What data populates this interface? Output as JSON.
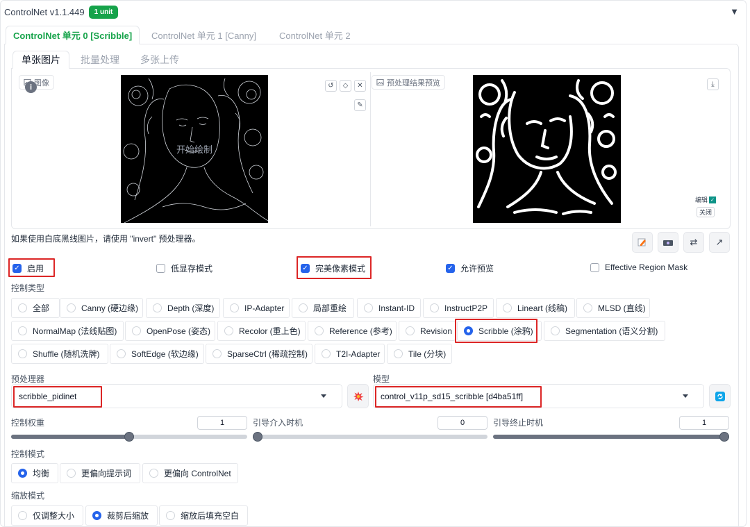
{
  "header": {
    "title": "ControlNet v1.1.449",
    "badge": "1 unit",
    "collapse_symbol": "▼"
  },
  "unit_tabs": [
    {
      "label": "ControlNet 单元 0 [Scribble]",
      "active": true
    },
    {
      "label": "ControlNet 单元 1 [Canny]",
      "active": false
    },
    {
      "label": "ControlNet 单元 2",
      "active": false
    }
  ],
  "image_tabs": [
    {
      "label": "单张图片",
      "active": true
    },
    {
      "label": "批量处理",
      "active": false
    },
    {
      "label": "多张上传",
      "active": false
    }
  ],
  "image_input": {
    "label": "图像",
    "label_icon": "image-icon",
    "info": "i",
    "overlay_text": "开始绘制",
    "tools": [
      "undo-icon",
      "eraser-icon",
      "close-icon",
      "brush-icon"
    ]
  },
  "preview": {
    "label": "预处理结果预览",
    "label_icon": "image-icon",
    "download_icon": "download-icon",
    "edit_label": "编辑",
    "close_label": "关闭"
  },
  "hint": "如果使用白底黑线图片，请使用 \"invert\" 预处理器。",
  "tool_buttons": [
    "edit-canvas-icon",
    "camera-icon",
    "swap-icon",
    "send-dimensions-icon"
  ],
  "checkboxes": [
    {
      "label": "启用",
      "checked": true,
      "highlight": true
    },
    {
      "label": "低显存模式",
      "checked": false,
      "highlight": false
    },
    {
      "label": "完美像素模式",
      "checked": true,
      "highlight": true
    },
    {
      "label": "允许预览",
      "checked": true,
      "highlight": false
    },
    {
      "label": "Effective Region Mask",
      "checked": false,
      "highlight": false
    }
  ],
  "control_type": {
    "label": "控制类型",
    "rows": [
      [
        {
          "label": "全部",
          "selected": false
        },
        {
          "label": "Canny (硬边缘)",
          "selected": false
        },
        {
          "label": "Depth (深度)",
          "selected": false
        },
        {
          "label": "IP-Adapter",
          "selected": false
        },
        {
          "label": "局部重绘",
          "selected": false
        },
        {
          "label": "Instant-ID",
          "selected": false
        },
        {
          "label": "InstructP2P",
          "selected": false
        },
        {
          "label": "Lineart (线稿)",
          "selected": false
        },
        {
          "label": "MLSD (直线)",
          "selected": false
        }
      ],
      [
        {
          "label": "NormalMap (法线贴图)",
          "selected": false
        },
        {
          "label": "OpenPose (姿态)",
          "selected": false
        },
        {
          "label": "Recolor (重上色)",
          "selected": false
        },
        {
          "label": "Reference (参考)",
          "selected": false
        },
        {
          "label": "Revision",
          "selected": false
        },
        {
          "label": "Scribble (涂鸦)",
          "selected": true
        },
        {
          "label": "Segmentation (语义分割)",
          "selected": false
        }
      ],
      [
        {
          "label": "Shuffle (随机洗牌)",
          "selected": false
        },
        {
          "label": "SoftEdge (软边缘)",
          "selected": false
        },
        {
          "label": "SparseCtrl (稀疏控制)",
          "selected": false
        },
        {
          "label": "T2I-Adapter",
          "selected": false
        },
        {
          "label": "Tile (分块)",
          "selected": false
        }
      ]
    ]
  },
  "preprocessor": {
    "label": "预处理器",
    "value": "scribble_pidinet",
    "run_icon": "explosion-icon"
  },
  "model": {
    "label": "模型",
    "value": "control_v11p_sd15_scribble [d4ba51ff]",
    "refresh_icon": "refresh-icon"
  },
  "sliders": [
    {
      "label": "控制权重",
      "value": "1",
      "fraction": 0.5
    },
    {
      "label": "引导介入时机",
      "value": "0",
      "fraction": 0.0
    },
    {
      "label": "引导终止时机",
      "value": "1",
      "fraction": 1.0
    }
  ],
  "control_mode": {
    "label": "控制模式",
    "options": [
      {
        "label": "均衡",
        "selected": true
      },
      {
        "label": "更偏向提示词",
        "selected": false
      },
      {
        "label": "更偏向 ControlNet",
        "selected": false
      }
    ]
  },
  "resize_mode": {
    "label": "缩放模式",
    "options": [
      {
        "label": "仅调整大小",
        "selected": false
      },
      {
        "label": "裁剪后缩放",
        "selected": true
      },
      {
        "label": "缩放后填充空白",
        "selected": false
      }
    ]
  },
  "colors": {
    "accent": "#16a34a",
    "checkbox": "#2563eb",
    "highlight": "#dc2626"
  }
}
